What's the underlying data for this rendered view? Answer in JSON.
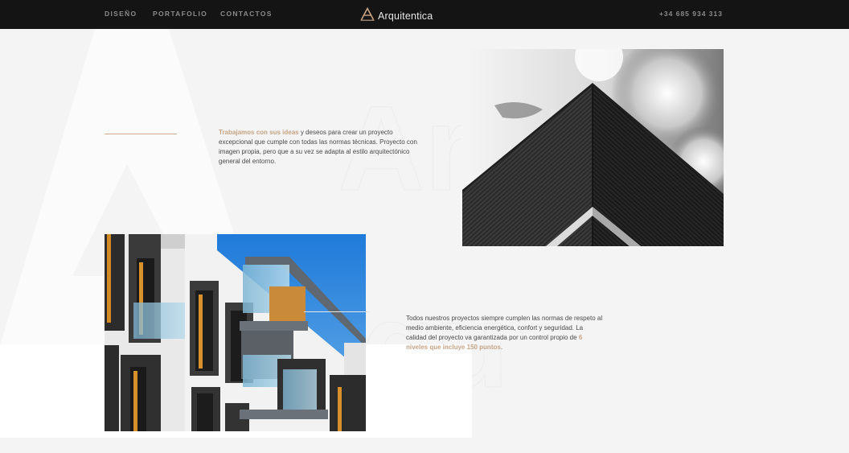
{
  "nav": {
    "links": [
      "DISEÑO",
      "PORTAFOLIO",
      "CONTACTOS"
    ],
    "brand": "Arquitentica",
    "phone": "+34 685 934 313"
  },
  "section_1": {
    "highlight": "Trabajamos con sus ideas",
    "body": " y deseos para crear un proyecto excepcional que cumple con todas las normas técnicas. Proyecto con imagen propia, pero que a su vez se adapta al estilo arquitectónico general del entorno."
  },
  "section_2": {
    "body": "Todos nuestros proyectos siempre cumplen las normas de respeto al medio ambiente, eficiencia energética, confort y seguridad. La calidad del proyecto va garantizada por un control propio de ",
    "highlight": "6 niveles que incluye 150 puntos",
    "tail": "."
  },
  "colors": {
    "accent": "#c8a383",
    "header": "#141414",
    "background": "#f4f4f4"
  },
  "icons": {
    "brand": "triangle-logo-icon"
  }
}
